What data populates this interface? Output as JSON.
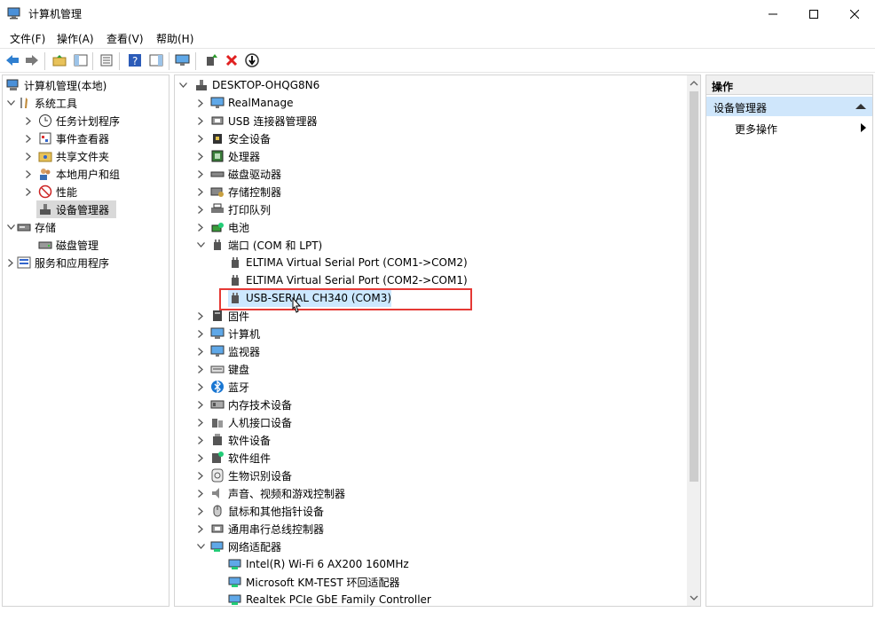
{
  "window": {
    "title": "计算机管理"
  },
  "menu": [
    {
      "label": "文件(F)"
    },
    {
      "label": "操作(A)"
    },
    {
      "label": "查看(V)"
    },
    {
      "label": "帮助(H)"
    }
  ],
  "toolbar_icons": [
    "back-arrow-icon",
    "forward-arrow-icon",
    "folder-up-icon",
    "show-hide-tree-icon",
    "properties-icon",
    "help-icon",
    "show-action-pane-icon",
    "monitor-icon",
    "update-driver-icon",
    "uninstall-x-icon",
    "scan-hardware-icon"
  ],
  "left_tree": [
    {
      "label": "计算机管理(本地)",
      "icon": "computer-management-icon"
    },
    {
      "label": "系统工具",
      "icon": "tools-icon"
    },
    {
      "label": "任务计划程序",
      "icon": "clock-icon"
    },
    {
      "label": "事件查看器",
      "icon": "event-viewer-icon"
    },
    {
      "label": "共享文件夹",
      "icon": "shared-folder-icon"
    },
    {
      "label": "本地用户和组",
      "icon": "users-icon"
    },
    {
      "label": "性能",
      "icon": "performance-icon"
    },
    {
      "label": "设备管理器",
      "icon": "device-manager-icon"
    },
    {
      "label": "存储",
      "icon": "storage-icon"
    },
    {
      "label": "磁盘管理",
      "icon": "disk-icon"
    },
    {
      "label": "服务和应用程序",
      "icon": "services-icon"
    }
  ],
  "device_tree": {
    "root": "DESKTOP-OHQG8N6",
    "items": [
      {
        "label": "RealManage",
        "icon": "monitor-icon"
      },
      {
        "label": "USB 连接器管理器",
        "icon": "usb-icon"
      },
      {
        "label": "安全设备",
        "icon": "security-icon"
      },
      {
        "label": "处理器",
        "icon": "cpu-icon"
      },
      {
        "label": "磁盘驱动器",
        "icon": "disk-drive-icon"
      },
      {
        "label": "存储控制器",
        "icon": "storage-controller-icon"
      },
      {
        "label": "打印队列",
        "icon": "printer-icon"
      },
      {
        "label": "电池",
        "icon": "battery-icon"
      },
      {
        "label": "端口 (COM 和 LPT)",
        "icon": "port-icon"
      },
      {
        "label": "ELTIMA Virtual Serial Port (COM1->COM2)",
        "icon": "port-icon"
      },
      {
        "label": "ELTIMA Virtual Serial Port (COM2->COM1)",
        "icon": "port-icon"
      },
      {
        "label": "USB-SERIAL CH340 (COM3)",
        "icon": "port-icon"
      },
      {
        "label": "固件",
        "icon": "firmware-icon"
      },
      {
        "label": "计算机",
        "icon": "computer-icon"
      },
      {
        "label": "监视器",
        "icon": "monitor-icon"
      },
      {
        "label": "键盘",
        "icon": "keyboard-icon"
      },
      {
        "label": "蓝牙",
        "icon": "bluetooth-icon"
      },
      {
        "label": "内存技术设备",
        "icon": "memory-icon"
      },
      {
        "label": "人机接口设备",
        "icon": "hid-icon"
      },
      {
        "label": "软件设备",
        "icon": "software-device-icon"
      },
      {
        "label": "软件组件",
        "icon": "software-component-icon"
      },
      {
        "label": "生物识别设备",
        "icon": "fingerprint-icon"
      },
      {
        "label": "声音、视频和游戏控制器",
        "icon": "speaker-icon"
      },
      {
        "label": "鼠标和其他指针设备",
        "icon": "mouse-icon"
      },
      {
        "label": "通用串行总线控制器",
        "icon": "usb-icon"
      },
      {
        "label": "网络适配器",
        "icon": "network-icon"
      },
      {
        "label": "Intel(R) Wi-Fi 6 AX200 160MHz",
        "icon": "network-icon"
      },
      {
        "label": "Microsoft KM-TEST 环回适配器",
        "icon": "network-icon"
      },
      {
        "label": "Realtek PCIe GbE Family Controller",
        "icon": "network-icon"
      }
    ]
  },
  "actions": {
    "header": "操作",
    "section": "设备管理器",
    "more": "更多操作"
  },
  "colors": {
    "selection_blue": "#cce8ff",
    "highlight_red": "#e53935",
    "selection_gray": "#d9d9d9"
  }
}
